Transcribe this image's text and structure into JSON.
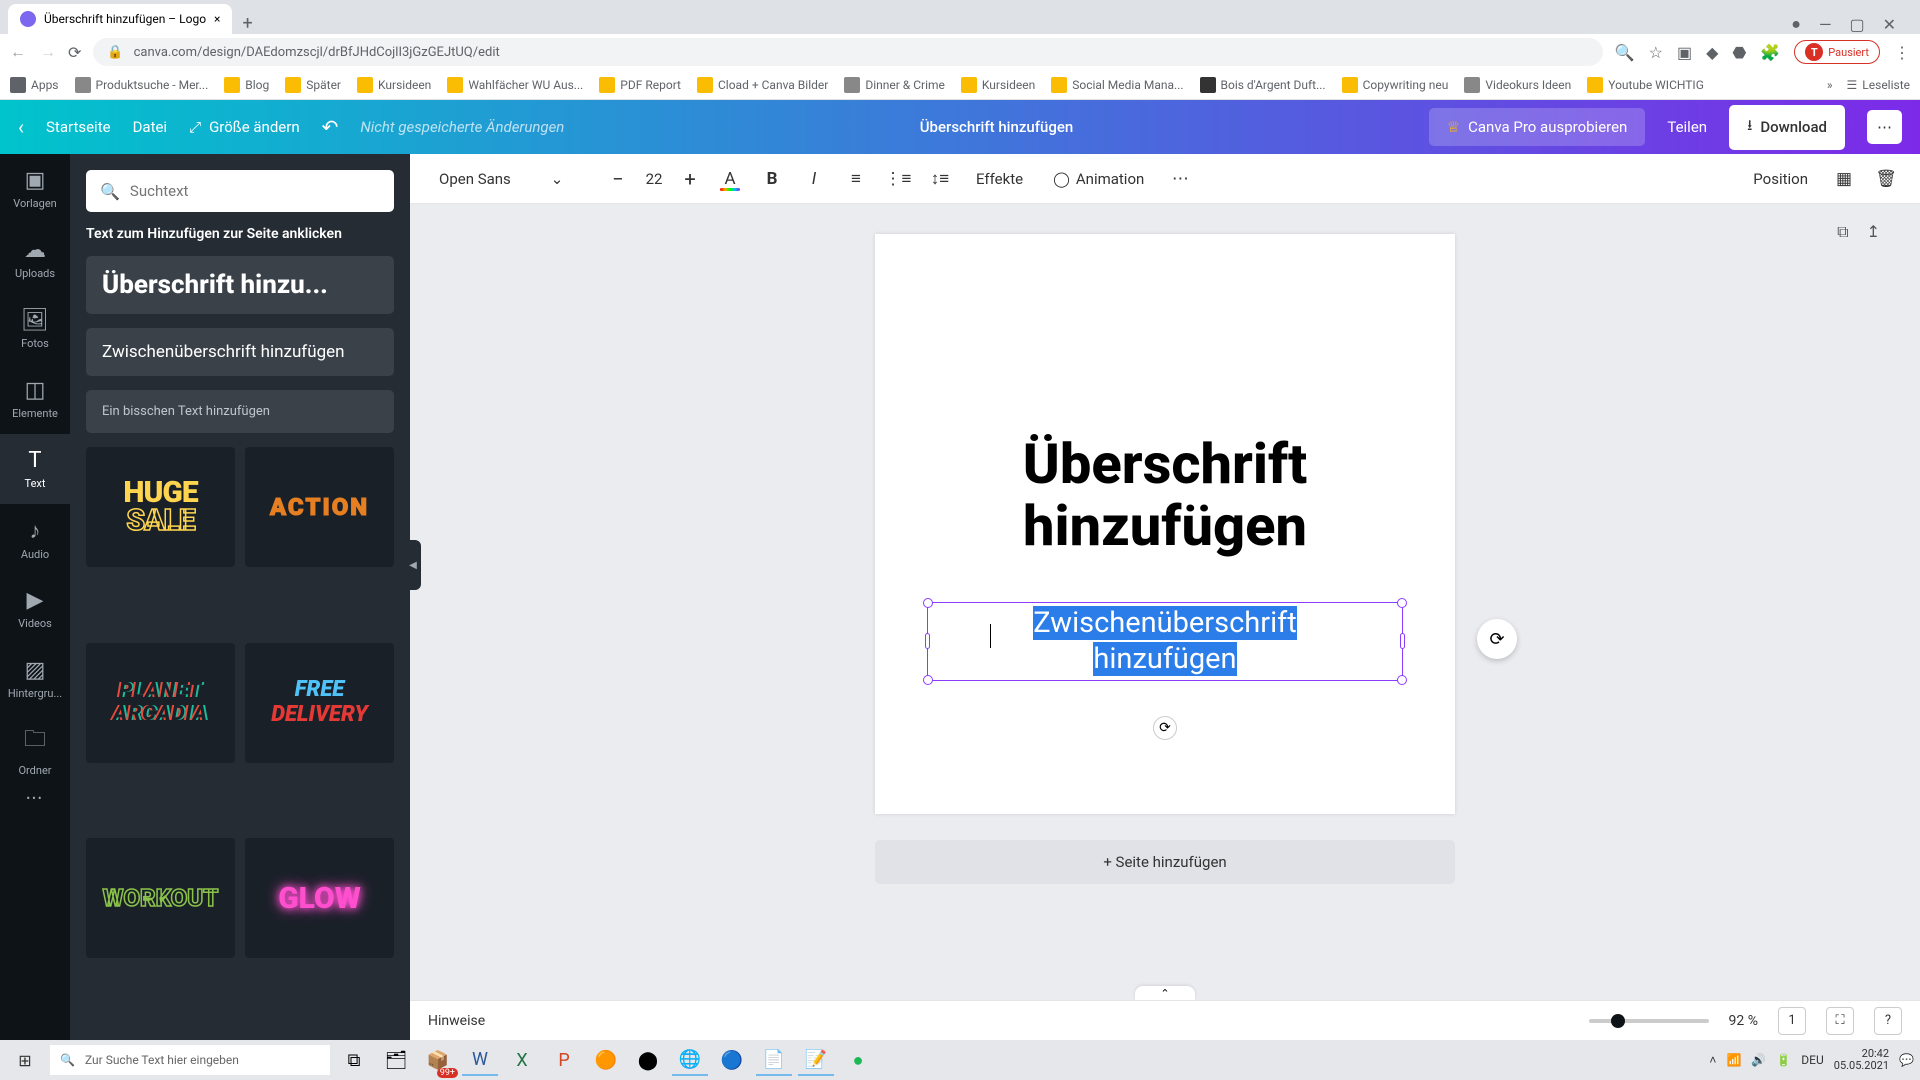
{
  "browser": {
    "tab_title": "Überschrift hinzufügen – Logo",
    "url": "canva.com/design/DAEdomzscjl/drBfJHdCojlI3jGzGEJtUQ/edit",
    "pause_label": "Pausiert",
    "avatar_letter": "T",
    "bookmarks": [
      "Apps",
      "Produktsuche - Mer...",
      "Blog",
      "Später",
      "Kursideen",
      "Wahlfächer WU Aus...",
      "PDF Report",
      "Cload + Canva Bilder",
      "Dinner & Crime",
      "Kursideen",
      "Social Media Mana...",
      "Bois d'Argent Duft...",
      "Copywriting neu",
      "Videokurs Ideen",
      "Youtube WICHTIG"
    ],
    "readlist": "Leseliste"
  },
  "canva_top": {
    "home": "Startseite",
    "file": "Datei",
    "resize": "Größe ändern",
    "unsaved": "Nicht gespeicherte Änderungen",
    "title": "Überschrift hinzufügen",
    "pro": "Canva Pro ausprobieren",
    "share": "Teilen",
    "download": "Download"
  },
  "rail": {
    "templates": "Vorlagen",
    "uploads": "Uploads",
    "photos": "Fotos",
    "elements": "Elemente",
    "text": "Text",
    "audio": "Audio",
    "videos": "Videos",
    "background": "Hintergru...",
    "folders": "Ordner"
  },
  "panel": {
    "search_placeholder": "Suchtext",
    "heading": "Text zum Hinzufügen zur Seite anklicken",
    "add_h1": "Überschrift hinzu...",
    "add_h2": "Zwischenüberschrift hinzufügen",
    "add_body": "Ein bisschen Text hinzufügen",
    "tmpl_hugesale_l1": "HUGE",
    "tmpl_hugesale_l2": "SALE",
    "tmpl_action": "ACTION",
    "tmpl_planet_l1": "PLANET",
    "tmpl_planet_l2": "ARCADIA",
    "tmpl_free_l1": "FREE",
    "tmpl_free_l2": "DELIVERY",
    "tmpl_workout": "WORKOUT",
    "tmpl_glow": "GLOW"
  },
  "toolbar": {
    "font": "Open Sans",
    "size": "22",
    "effects": "Effekte",
    "animation": "Animation",
    "position": "Position"
  },
  "canvas": {
    "heading_l1": "Überschrift",
    "heading_l2": "hinzufügen",
    "sub_l1": "Zwischenüberschrift",
    "sub_l2": "hinzufügen",
    "add_page": "+ Seite hinzufügen"
  },
  "footer": {
    "notes": "Hinweise",
    "zoom": "92 %",
    "page_indicator": "1"
  },
  "taskbar": {
    "search_placeholder": "Zur Suche Text hier eingeben",
    "badge": "99+",
    "lang": "DEU",
    "time": "20:42",
    "date": "05.05.2021"
  }
}
